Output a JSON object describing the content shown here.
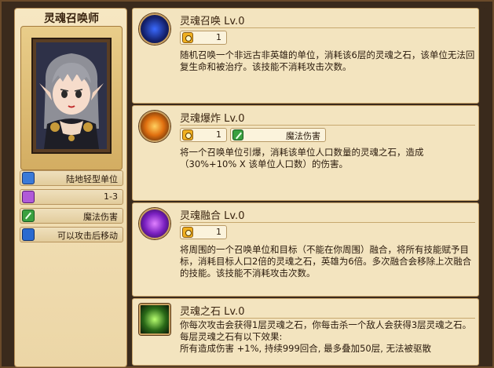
{
  "hero": {
    "name": "灵魂召唤师",
    "stats": [
      {
        "icon": "unit-type-icon",
        "text": "陆地轻型单位"
      },
      {
        "icon": "range-icon",
        "text": "1-3"
      },
      {
        "icon": "damage-type-icon",
        "text": "魔法伤害"
      },
      {
        "icon": "move-icon",
        "text": "可以攻击后移动"
      }
    ]
  },
  "skills": [
    {
      "title": "灵魂召唤 Lv.0",
      "icon": "soul-summon-icon",
      "cooldown": "1",
      "damage_type": "",
      "desc": "随机召唤一个非远古非英雄的单位，消耗该6层的灵魂之石，该单位无法回复生命和被治疗。该技能不消耗攻击次数。"
    },
    {
      "title": "灵魂爆炸 Lv.0",
      "icon": "soul-explosion-icon",
      "cooldown": "1",
      "damage_type": "魔法伤害",
      "desc": "将一个召唤单位引爆，消耗该单位人口数量的灵魂之石，造成（30%+10% X 该单位人口数）的伤害。"
    },
    {
      "title": "灵魂融合 Lv.0",
      "icon": "soul-fusion-icon",
      "cooldown": "1",
      "damage_type": "",
      "desc": "将周围的一个召唤单位和目标（不能在你周围）融合，将所有技能赋予目标，消耗目标人口2倍的灵魂之石，英雄为6倍。多次融合会移除上次融合的技能。该技能不消耗攻击次数。"
    },
    {
      "title": "灵魂之石 Lv.0",
      "icon": "soul-stone-icon",
      "desc_lines": [
        "你每次攻击会获得1层灵魂之石，你每击杀一个敌人会获得3层灵魂之石。每层灵魂之石有以下效果:",
        "所有造成伤害 +1%, 持续999回合, 最多叠加50层, 无法被驱散"
      ]
    }
  ]
}
